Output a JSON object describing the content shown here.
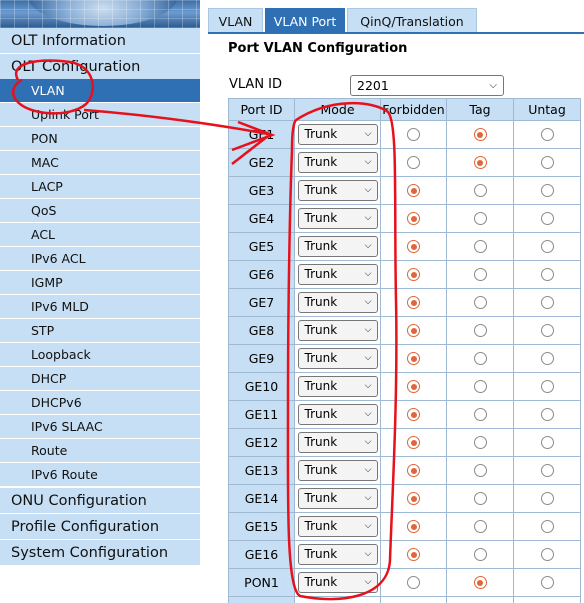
{
  "sidebar": {
    "top_items": [
      {
        "label": "OLT Information"
      },
      {
        "label": "OLT Configuration"
      }
    ],
    "sub_items": [
      {
        "label": "VLAN",
        "active": true
      },
      {
        "label": "Uplink Port"
      },
      {
        "label": "PON"
      },
      {
        "label": "MAC"
      },
      {
        "label": "LACP"
      },
      {
        "label": "QoS"
      },
      {
        "label": "ACL"
      },
      {
        "label": "IPv6 ACL"
      },
      {
        "label": "IGMP"
      },
      {
        "label": "IPv6 MLD"
      },
      {
        "label": "STP"
      },
      {
        "label": "Loopback"
      },
      {
        "label": "DHCP"
      },
      {
        "label": "DHCPv6"
      },
      {
        "label": "IPv6 SLAAC"
      },
      {
        "label": "Route"
      },
      {
        "label": "IPv6 Route"
      }
    ],
    "bottom_items": [
      {
        "label": "ONU Configuration"
      },
      {
        "label": "Profile Configuration"
      },
      {
        "label": "System Configuration"
      }
    ]
  },
  "tabs": [
    {
      "label": "VLAN",
      "active": false
    },
    {
      "label": "VLAN Port",
      "active": true
    },
    {
      "label": "QinQ/Translation",
      "active": false
    }
  ],
  "page_title": "Port VLAN Configuration",
  "vlan_id": {
    "label": "VLAN ID",
    "value": "2201"
  },
  "table": {
    "headers": [
      "Port ID",
      "Mode",
      "Forbidden",
      "Tag",
      "Untag"
    ],
    "rows": [
      {
        "port": "GE1",
        "mode": "Trunk",
        "selected": "Tag"
      },
      {
        "port": "GE2",
        "mode": "Trunk",
        "selected": "Tag"
      },
      {
        "port": "GE3",
        "mode": "Trunk",
        "selected": "Forbidden"
      },
      {
        "port": "GE4",
        "mode": "Trunk",
        "selected": "Forbidden"
      },
      {
        "port": "GE5",
        "mode": "Trunk",
        "selected": "Forbidden"
      },
      {
        "port": "GE6",
        "mode": "Trunk",
        "selected": "Forbidden"
      },
      {
        "port": "GE7",
        "mode": "Trunk",
        "selected": "Forbidden"
      },
      {
        "port": "GE8",
        "mode": "Trunk",
        "selected": "Forbidden"
      },
      {
        "port": "GE9",
        "mode": "Trunk",
        "selected": "Forbidden"
      },
      {
        "port": "GE10",
        "mode": "Trunk",
        "selected": "Forbidden"
      },
      {
        "port": "GE11",
        "mode": "Trunk",
        "selected": "Forbidden"
      },
      {
        "port": "GE12",
        "mode": "Trunk",
        "selected": "Forbidden"
      },
      {
        "port": "GE13",
        "mode": "Trunk",
        "selected": "Forbidden"
      },
      {
        "port": "GE14",
        "mode": "Trunk",
        "selected": "Forbidden"
      },
      {
        "port": "GE15",
        "mode": "Trunk",
        "selected": "Forbidden"
      },
      {
        "port": "GE16",
        "mode": "Trunk",
        "selected": "Forbidden"
      },
      {
        "port": "PON1",
        "mode": "Trunk",
        "selected": "Tag"
      },
      {
        "port": "",
        "mode": "",
        "selected": ""
      }
    ]
  },
  "colors": {
    "menu_bg": "#c6dff4",
    "menu_active": "#2f6fb3",
    "radio_selected": "#e0653a",
    "annotation": "#e8111b"
  }
}
